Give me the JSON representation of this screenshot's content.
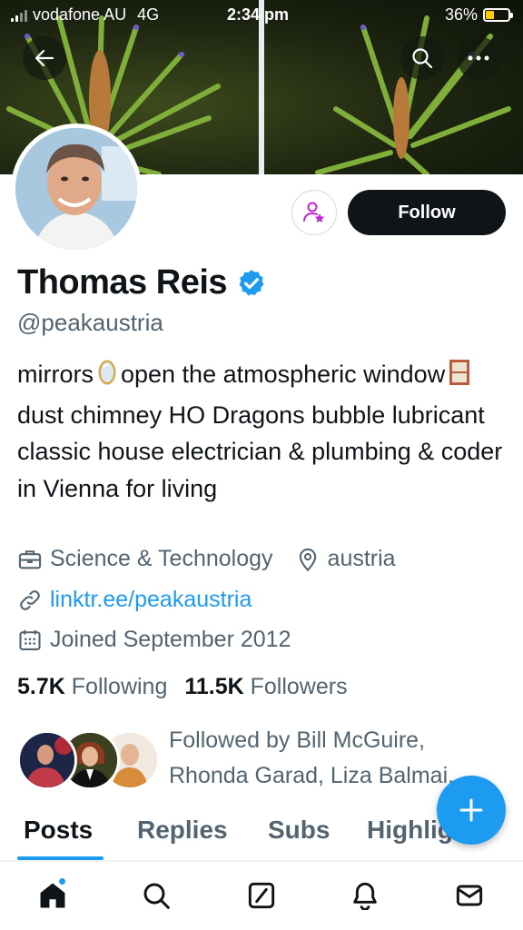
{
  "status_bar": {
    "carrier": "vodafone AU",
    "network": "4G",
    "time": "2:34 pm",
    "battery": "36%",
    "battery_level": 0.36
  },
  "profile": {
    "display_name": "Thomas Reis",
    "handle": "@peakaustria",
    "verified": true,
    "follow_label": "Follow",
    "bio_parts": [
      "mirrors",
      "open the atmospheric window",
      "dust chimney HO Dragons bubble lubricant classic house electrician & plumbing & coder in Vienna for living"
    ],
    "category": "Science & Technology",
    "location": "austria",
    "website": "linktr.ee/peakaustria",
    "joined": "Joined September 2012",
    "following_count": "5.7K",
    "following_label": "Following",
    "followers_count": "11.5K",
    "followers_label": "Followers",
    "followed_by_line1": "Followed by Bill McGuire,",
    "followed_by_line2": "Rhonda Garad, Liza Balmai..."
  },
  "tabs": [
    {
      "label": "Posts",
      "active": true
    },
    {
      "label": "Replies"
    },
    {
      "label": "Subs"
    },
    {
      "label": "Highlights"
    }
  ],
  "bottom_nav": [
    "home-icon",
    "search-icon",
    "grok-icon",
    "notifications-icon",
    "messages-icon"
  ],
  "colors": {
    "accent": "#1d9bf0",
    "text": "#0f1419",
    "secondary": "#536471",
    "subscribe_icon": "#c026d3"
  }
}
